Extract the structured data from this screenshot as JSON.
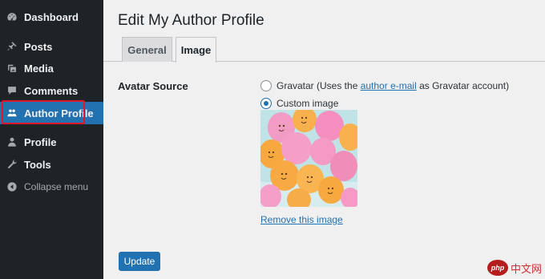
{
  "sidebar": {
    "items": [
      {
        "label": "Dashboard",
        "icon": "dashboard-icon"
      },
      {
        "label": "Posts",
        "icon": "pin-icon"
      },
      {
        "label": "Media",
        "icon": "media-icon"
      },
      {
        "label": "Comments",
        "icon": "comment-icon"
      },
      {
        "label": "Author Profile",
        "icon": "users-icon",
        "active": true
      },
      {
        "label": "Profile",
        "icon": "user-icon"
      },
      {
        "label": "Tools",
        "icon": "wrench-icon"
      },
      {
        "label": "Collapse menu",
        "icon": "collapse-icon"
      }
    ]
  },
  "page": {
    "title": "Edit My Author Profile",
    "tabs": [
      {
        "label": "General",
        "active": false
      },
      {
        "label": "Image",
        "active": true
      }
    ]
  },
  "avatar_source": {
    "label": "Avatar Source",
    "options": [
      {
        "prefix": "Gravatar (Uses the ",
        "link": "author e-mail",
        "suffix": " as Gravatar account)",
        "checked": false
      },
      {
        "label": "Custom image",
        "checked": true
      }
    ],
    "remove_label": "Remove this image"
  },
  "actions": {
    "update_label": "Update"
  },
  "watermark": {
    "logo": "php",
    "text": "中文网"
  },
  "colors": {
    "sidebar_bg": "#1d2327",
    "accent": "#2271b1",
    "highlight": "#e0152b",
    "page_bg": "#f0f0f1"
  }
}
